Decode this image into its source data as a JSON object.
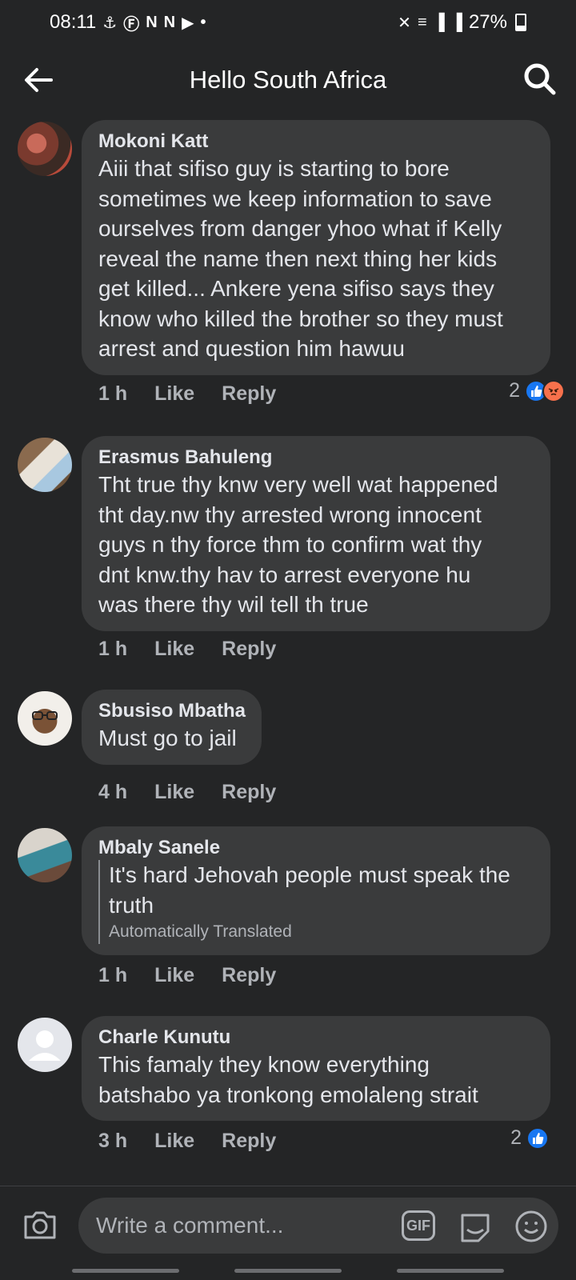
{
  "status_bar": {
    "time": "08:11",
    "left_icons": [
      "usb-icon",
      "facebook-icon",
      "news-icon",
      "news-icon",
      "youtube-icon",
      "dot-icon"
    ],
    "right_icons": [
      "mute-icon",
      "wifi-icon",
      "signal-icon",
      "signal-icon"
    ],
    "battery": "27%",
    "battery_level": 0.27
  },
  "header": {
    "title": "Hello South Africa",
    "back_icon": "back-arrow-icon",
    "search_icon": "search-icon"
  },
  "comments": [
    {
      "author": "Mokoni Katt",
      "text": "Aiii that sifiso guy is starting to bore\nsometimes we keep information to save\nourselves from danger yhoo what if Kelly\nreveal the name then next thing her kids\nget killed... Ankere yena sifiso says they\nknow who killed the brother so they must\narrest and question him hawuu",
      "time": "1 h",
      "like": "Like",
      "reply": "Reply",
      "reaction_count": "2",
      "reactions": [
        "like",
        "angry"
      ]
    },
    {
      "author": "Erasmus Bahuleng",
      "text": "Tht true thy knw very well wat happened\ntht day.nw thy arrested wrong innocent\nguys n thy force thm to confirm wat thy\ndnt knw.thy hav to arrest everyone hu\nwas there thy wil tell th true",
      "time": "1 h",
      "like": "Like",
      "reply": "Reply"
    },
    {
      "author": "Sbusiso Mbatha",
      "text": "Must go to jail",
      "time": "4 h",
      "like": "Like",
      "reply": "Reply"
    },
    {
      "author": "Mbaly Sanele",
      "text": "It's hard Jehovah people must speak the\ntruth",
      "translated_label": "Automatically Translated",
      "time": "1 h",
      "like": "Like",
      "reply": "Reply"
    },
    {
      "author": "Charle Kunutu",
      "text": "This famaly they know everything\nbatshabo ya tronkong emolaleng strait",
      "time": "3 h",
      "like": "Like",
      "reply": "Reply",
      "reaction_count": "2",
      "reactions": [
        "like"
      ]
    }
  ],
  "composer": {
    "placeholder": "Write a comment...",
    "gif_label": "GIF",
    "camera_icon": "camera-icon",
    "sticker_icon": "sticker-icon",
    "emoji_icon": "emoji-icon"
  },
  "colors": {
    "background": "#242526",
    "bubble": "#3a3b3c",
    "text": "#e4e6eb",
    "secondary_text": "#b0b3b8",
    "like_blue": "#1877f2",
    "angry_orange": "#f7714c"
  }
}
